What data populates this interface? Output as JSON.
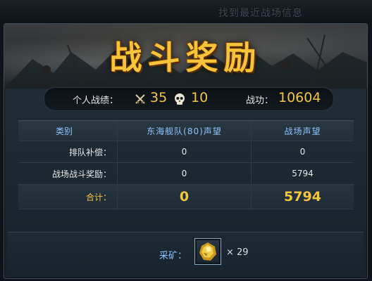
{
  "top_strip_text": "找到最近战场信息",
  "title": "战斗奖励",
  "stats": {
    "personal_label": "个人战绩：",
    "kills": "35",
    "deaths": "10",
    "merit_label": "战功：",
    "merit_value": "10604"
  },
  "table": {
    "headers": [
      "类别",
      "东海舰队(80)声望",
      "战场声望"
    ],
    "rows": [
      {
        "label": "排队补偿：",
        "col1": "0",
        "col2": "0"
      },
      {
        "label": "战场战斗奖励：",
        "col1": "0",
        "col2": "5794"
      }
    ],
    "total": {
      "label": "合计：",
      "col1": "0",
      "col2": "5794"
    }
  },
  "reward": {
    "label": "采矿：",
    "icon": "gold-ore-icon",
    "count": "× 29"
  },
  "colors": {
    "gold": "#f4c63e",
    "header_blue": "#8fc4ff",
    "panel_bg": "#1c2832"
  }
}
